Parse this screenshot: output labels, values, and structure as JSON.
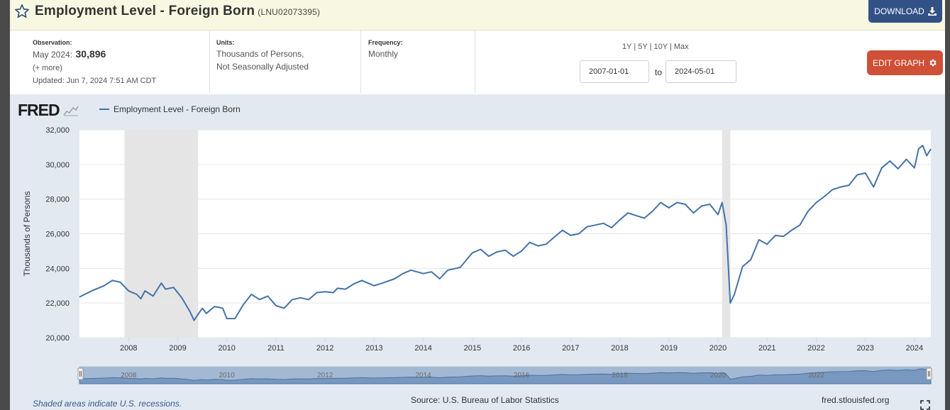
{
  "header": {
    "title": "Employment Level - Foreign Born",
    "series_id": "(LNU02073395)",
    "download_label": "DOWNLOAD"
  },
  "meta": {
    "observation_label": "Observation:",
    "observation_period": "May 2024:",
    "observation_value": "30,896",
    "more_link": "(+ more)",
    "updated": "Updated: Jun 7, 2024 7:51 AM CDT",
    "units_label": "Units:",
    "units_line1": "Thousands of Persons,",
    "units_line2": "Not Seasonally Adjusted",
    "frequency_label": "Frequency:",
    "frequency_value": "Monthly",
    "range_1y": "1Y",
    "range_5y": "5Y",
    "range_10y": "10Y",
    "range_max": "Max",
    "range_sep": "|",
    "start_date": "2007-01-01",
    "to_label": "to",
    "end_date": "2024-05-01",
    "edit_label": "EDIT GRAPH"
  },
  "chart": {
    "logo": "FRED",
    "legend_label": "Employment Level - Foreign Born",
    "footer_note": "Shaded areas indicate U.S. recessions.",
    "source": "Source: U.S. Bureau of Labor Statistics",
    "site": "fred.stlouisfed.org",
    "line_color": "#4572a7",
    "recession_color": "#e5e5e5"
  },
  "chart_data": {
    "type": "line",
    "title": "",
    "xlabel": "",
    "ylabel": "Thousands of Persons",
    "ylim": [
      20000,
      32000
    ],
    "xlim": [
      "2007-01-01",
      "2024-05-01"
    ],
    "yticks": [
      "20,000",
      "22,000",
      "24,000",
      "26,000",
      "28,000",
      "30,000",
      "32,000"
    ],
    "xticks": [
      "2008",
      "2009",
      "2010",
      "2011",
      "2012",
      "2013",
      "2014",
      "2015",
      "2016",
      "2017",
      "2018",
      "2019",
      "2020",
      "2021",
      "2022",
      "2023",
      "2024"
    ],
    "grid": true,
    "recessions": [
      [
        "2007-12-01",
        "2009-06-01"
      ],
      [
        "2020-02-01",
        "2020-04-01"
      ]
    ],
    "series": [
      {
        "name": "Employment Level - Foreign Born",
        "points": [
          [
            "2007-01",
            22350
          ],
          [
            "2007-04",
            22700
          ],
          [
            "2007-07",
            23000
          ],
          [
            "2007-09",
            23300
          ],
          [
            "2007-11",
            23200
          ],
          [
            "2008-01",
            22700
          ],
          [
            "2008-03",
            22500
          ],
          [
            "2008-04",
            22250
          ],
          [
            "2008-05",
            22700
          ],
          [
            "2008-07",
            22400
          ],
          [
            "2008-09",
            23150
          ],
          [
            "2008-10",
            22800
          ],
          [
            "2008-12",
            22900
          ],
          [
            "2009-02",
            22300
          ],
          [
            "2009-04",
            21500
          ],
          [
            "2009-05",
            21000
          ],
          [
            "2009-07",
            21700
          ],
          [
            "2009-08",
            21400
          ],
          [
            "2009-10",
            21800
          ],
          [
            "2009-12",
            21700
          ],
          [
            "2010-01",
            21100
          ],
          [
            "2010-03",
            21100
          ],
          [
            "2010-05",
            21900
          ],
          [
            "2010-07",
            22500
          ],
          [
            "2010-09",
            22200
          ],
          [
            "2010-11",
            22400
          ],
          [
            "2011-01",
            21850
          ],
          [
            "2011-03",
            21700
          ],
          [
            "2011-05",
            22200
          ],
          [
            "2011-07",
            22300
          ],
          [
            "2011-09",
            22200
          ],
          [
            "2011-11",
            22600
          ],
          [
            "2012-01",
            22650
          ],
          [
            "2012-03",
            22600
          ],
          [
            "2012-04",
            22850
          ],
          [
            "2012-06",
            22800
          ],
          [
            "2012-08",
            23100
          ],
          [
            "2012-10",
            23300
          ],
          [
            "2013-01",
            23000
          ],
          [
            "2013-03",
            23150
          ],
          [
            "2013-06",
            23400
          ],
          [
            "2013-08",
            23700
          ],
          [
            "2013-10",
            23900
          ],
          [
            "2014-01",
            23700
          ],
          [
            "2014-03",
            23800
          ],
          [
            "2014-05",
            23400
          ],
          [
            "2014-07",
            23900
          ],
          [
            "2014-10",
            24050
          ],
          [
            "2015-01",
            24900
          ],
          [
            "2015-03",
            25100
          ],
          [
            "2015-05",
            24700
          ],
          [
            "2015-07",
            24950
          ],
          [
            "2015-09",
            25050
          ],
          [
            "2015-11",
            24700
          ],
          [
            "2016-01",
            25000
          ],
          [
            "2016-03",
            25500
          ],
          [
            "2016-05",
            25300
          ],
          [
            "2016-07",
            25400
          ],
          [
            "2016-09",
            25800
          ],
          [
            "2016-11",
            26200
          ],
          [
            "2017-01",
            25900
          ],
          [
            "2017-03",
            26000
          ],
          [
            "2017-05",
            26400
          ],
          [
            "2017-07",
            26500
          ],
          [
            "2017-09",
            26600
          ],
          [
            "2017-11",
            26350
          ],
          [
            "2018-01",
            26800
          ],
          [
            "2018-03",
            27200
          ],
          [
            "2018-05",
            27050
          ],
          [
            "2018-07",
            26900
          ],
          [
            "2018-09",
            27300
          ],
          [
            "2018-11",
            27800
          ],
          [
            "2019-01",
            27500
          ],
          [
            "2019-03",
            27800
          ],
          [
            "2019-05",
            27700
          ],
          [
            "2019-07",
            27200
          ],
          [
            "2019-09",
            27600
          ],
          [
            "2019-11",
            27700
          ],
          [
            "2020-01",
            27100
          ],
          [
            "2020-02",
            27800
          ],
          [
            "2020-03",
            26500
          ],
          [
            "2020-04",
            22000
          ],
          [
            "2020-05",
            22500
          ],
          [
            "2020-07",
            24100
          ],
          [
            "2020-09",
            24500
          ],
          [
            "2020-11",
            25650
          ],
          [
            "2021-01",
            25400
          ],
          [
            "2021-03",
            25900
          ],
          [
            "2021-05",
            25850
          ],
          [
            "2021-07",
            26200
          ],
          [
            "2021-09",
            26500
          ],
          [
            "2021-11",
            27300
          ],
          [
            "2022-01",
            27800
          ],
          [
            "2022-03",
            28150
          ],
          [
            "2022-05",
            28550
          ],
          [
            "2022-07",
            28700
          ],
          [
            "2022-09",
            28800
          ],
          [
            "2022-11",
            29400
          ],
          [
            "2023-01",
            29500
          ],
          [
            "2023-03",
            28700
          ],
          [
            "2023-05",
            29800
          ],
          [
            "2023-07",
            30200
          ],
          [
            "2023-09",
            29750
          ],
          [
            "2023-11",
            30300
          ],
          [
            "2024-01",
            29800
          ],
          [
            "2024-02",
            30900
          ],
          [
            "2024-03",
            31100
          ],
          [
            "2024-04",
            30500
          ],
          [
            "2024-05",
            30896
          ]
        ]
      }
    ]
  }
}
